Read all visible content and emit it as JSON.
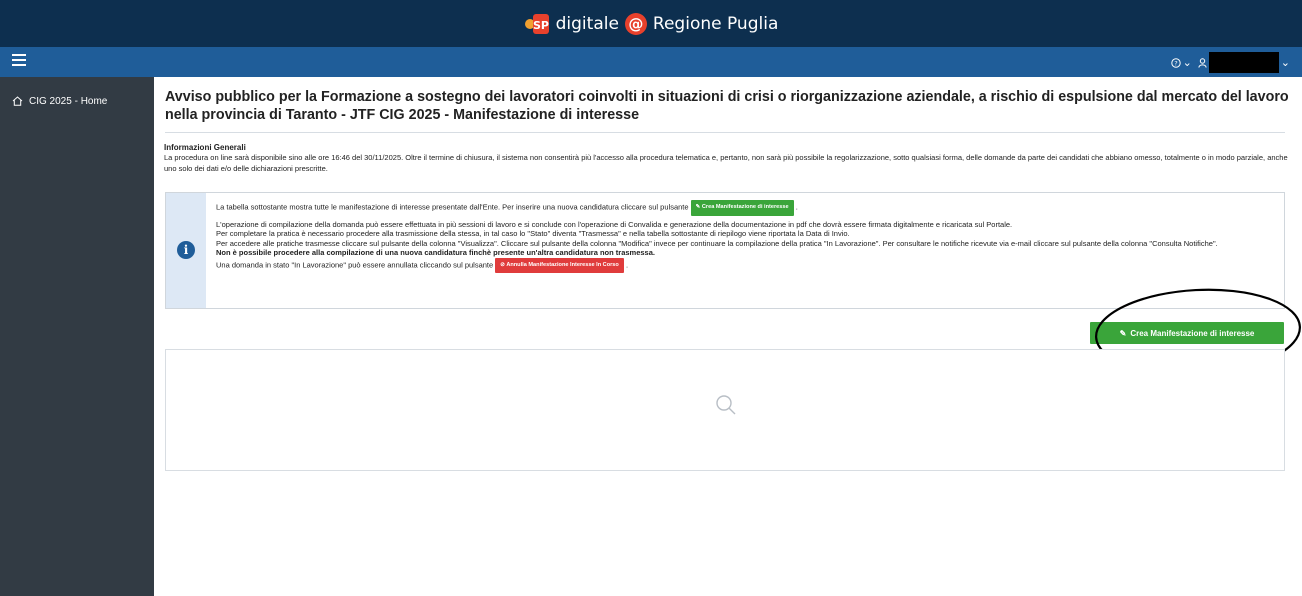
{
  "header": {
    "brand_logo_text": "SP",
    "brand_text_1": "digitale",
    "brand_at": "@",
    "brand_text_2": "Regione Puglia"
  },
  "navbar": {
    "help_icon": "question-circle-icon",
    "help_caret": "⌄",
    "user_icon": "user-icon",
    "user_caret": "⌄"
  },
  "sidebar": {
    "items": [
      {
        "label": "CIG 2025 - Home",
        "icon": "home-icon"
      }
    ]
  },
  "main": {
    "title": "Avviso pubblico per la Formazione a sostegno dei lavoratori coinvolti in situazioni di crisi o riorganizzazione aziendale, a rischio di espulsione dal mercato del lavoro nella provincia di Taranto - JTF CIG 2025 - Manifestazione di interesse",
    "general_title": "Informazioni Generali",
    "general_text": "La procedura on line sarà disponibile sino alle ore 16:46 del 30/11/2025. Oltre il termine di chiusura, il sistema non consentirà più l'accesso alla procedura telematica e, pertanto, non sarà più possibile la regolarizzazione, sotto qualsiasi forma, delle domande da parte dei candidati che abbiano omesso, totalmente o in modo parziale, anche uno solo dei dati e/o delle dichiarazioni prescritte.",
    "info": {
      "line1_pre": "La tabella sottostante mostra tutte le manifestazione di interesse presentate dall'Ente. Per inserire una nuova candidatura cliccare sul pulsante",
      "line1_btn": "Crea Manifestazione di interesse",
      "line1_post": ".",
      "line2": "L'operazione di compilazione della domanda può essere effettuata in più sessioni di lavoro e si conclude con l'operazione di Convalida e generazione della documentazione in pdf che dovrà essere firmata digitalmente e ricaricata sul Portale.",
      "line3": "Per completare la pratica è necessario procedere alla trasmissione della stessa, in tal caso lo \"Stato\" diventa \"Trasmessa\" e nella tabella sottostante di riepilogo viene riportata la Data di Invio.",
      "line4": "Per accedere alle pratiche trasmesse cliccare sul pulsante della colonna \"Visualizza\". Cliccare sul pulsante della colonna \"Modifica\" invece per continuare la compilazione della pratica \"In Lavorazione\". Per consultare le notifiche ricevute via e-mail cliccare sul pulsante della colonna \"Consulta Notifiche\".",
      "line5": "Non è possibile procedere alla compilazione di una nuova candidatura finchè presente un'altra candidatura non trasmessa.",
      "line6_pre": "Una domanda in stato \"In Lavorazione\" può essere annullata cliccando sul pulsante",
      "line6_btn": "Annulla Manifestazione Interesse In Corso",
      "line6_post": "."
    },
    "create_button": "Crea Manifestazione di interesse"
  },
  "colors": {
    "topbar": "#0d2f4f",
    "navbar": "#1f5d99",
    "sidebar": "#323b44",
    "green": "#3aa53a",
    "red": "#e03c3c"
  }
}
